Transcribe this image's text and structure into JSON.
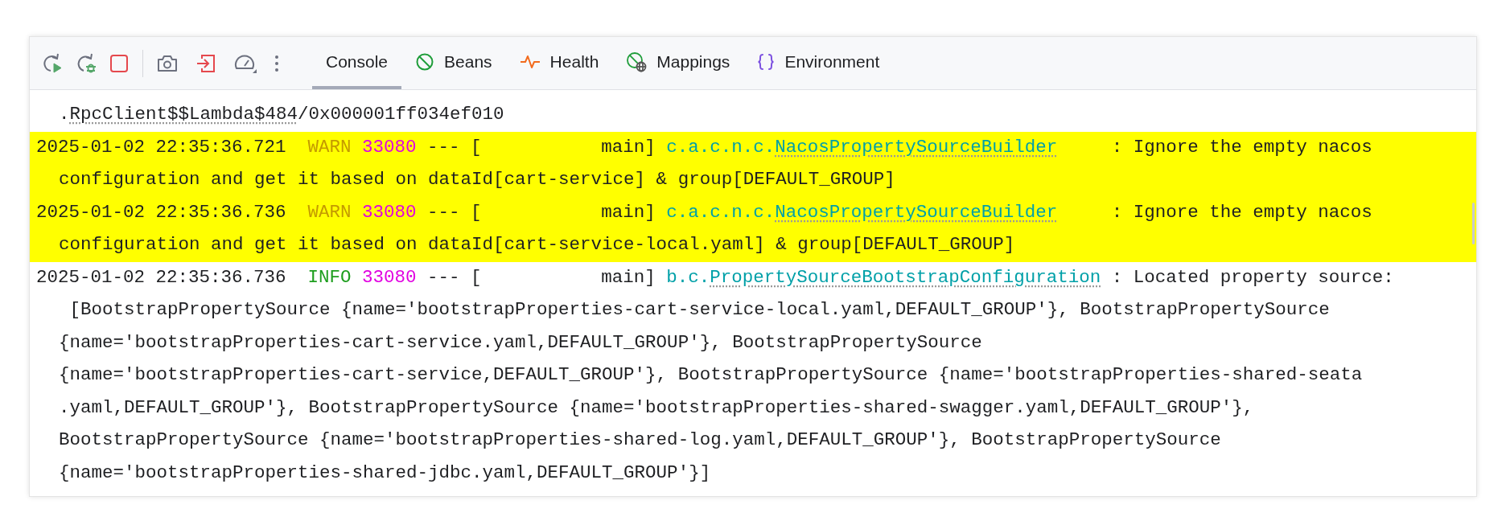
{
  "toolbar": {
    "tabs": [
      {
        "label": "Console",
        "selected": true
      },
      {
        "label": "Beans",
        "selected": false
      },
      {
        "label": "Health",
        "selected": false
      },
      {
        "label": "Mappings",
        "selected": false
      },
      {
        "label": "Environment",
        "selected": false
      }
    ]
  },
  "console": {
    "entries": [
      {
        "kind": "continuation",
        "highlighted": false,
        "lines": [
          [
            {
              "text": ".",
              "link": false
            },
            {
              "text": "RpcClient$$Lambda$484",
              "link": true
            },
            {
              "text": "/0x000001ff034ef010",
              "link": false
            }
          ]
        ]
      },
      {
        "kind": "log",
        "highlighted": true,
        "timestamp": "2025-01-02 22:35:36.721",
        "level": "WARN",
        "pid": "33080",
        "thread": "--- [           main]",
        "logger_package": "c.a.c.n.c.",
        "logger_class": "NacosPropertySourceBuilder",
        "message": ": Ignore the empty nacos",
        "lines": [
          [
            {
              "text": "configuration and get it based on dataId[cart-service] & group[DEFAULT_GROUP]",
              "link": false
            }
          ]
        ]
      },
      {
        "kind": "log",
        "highlighted": true,
        "timestamp": "2025-01-02 22:35:36.736",
        "level": "WARN",
        "pid": "33080",
        "thread": "--- [           main]",
        "logger_package": "c.a.c.n.c.",
        "logger_class": "NacosPropertySourceBuilder",
        "message": ": Ignore the empty nacos",
        "lines": [
          [
            {
              "text": "configuration and get it based on dataId[cart-service-local.yaml] & group[DEFAULT_GROUP]",
              "link": false
            }
          ]
        ]
      },
      {
        "kind": "log",
        "highlighted": false,
        "timestamp": "2025-01-02 22:35:36.736",
        "level": "INFO",
        "pid": "33080",
        "thread": "--- [           main]",
        "logger_package": "b.c.",
        "logger_class": "PropertySourceBootstrapConfiguration",
        "message": ": Located property source:",
        "lines": [
          [
            {
              "text": " [BootstrapPropertySource {name='bootstrapProperties-cart-service-local.yaml,DEFAULT_GROUP'}, BootstrapPropertySource",
              "link": false
            }
          ],
          [
            {
              "text": "{name='bootstrapProperties-cart-service.yaml,DEFAULT_GROUP'}, BootstrapPropertySource",
              "link": false
            }
          ],
          [
            {
              "text": "{name='bootstrapProperties-cart-service,DEFAULT_GROUP'}, BootstrapPropertySource {name='bootstrapProperties-shared-seata",
              "link": false
            }
          ],
          [
            {
              "text": ".yaml,DEFAULT_GROUP'}, BootstrapPropertySource {name='bootstrapProperties-shared-swagger.yaml,DEFAULT_GROUP'},",
              "link": false
            }
          ],
          [
            {
              "text": "BootstrapPropertySource {name='bootstrapProperties-shared-log.yaml,DEFAULT_GROUP'}, BootstrapPropertySource",
              "link": false
            }
          ],
          [
            {
              "text": "{name='bootstrapProperties-shared-jdbc.yaml,DEFAULT_GROUP'}]",
              "link": false
            }
          ]
        ]
      }
    ]
  }
}
